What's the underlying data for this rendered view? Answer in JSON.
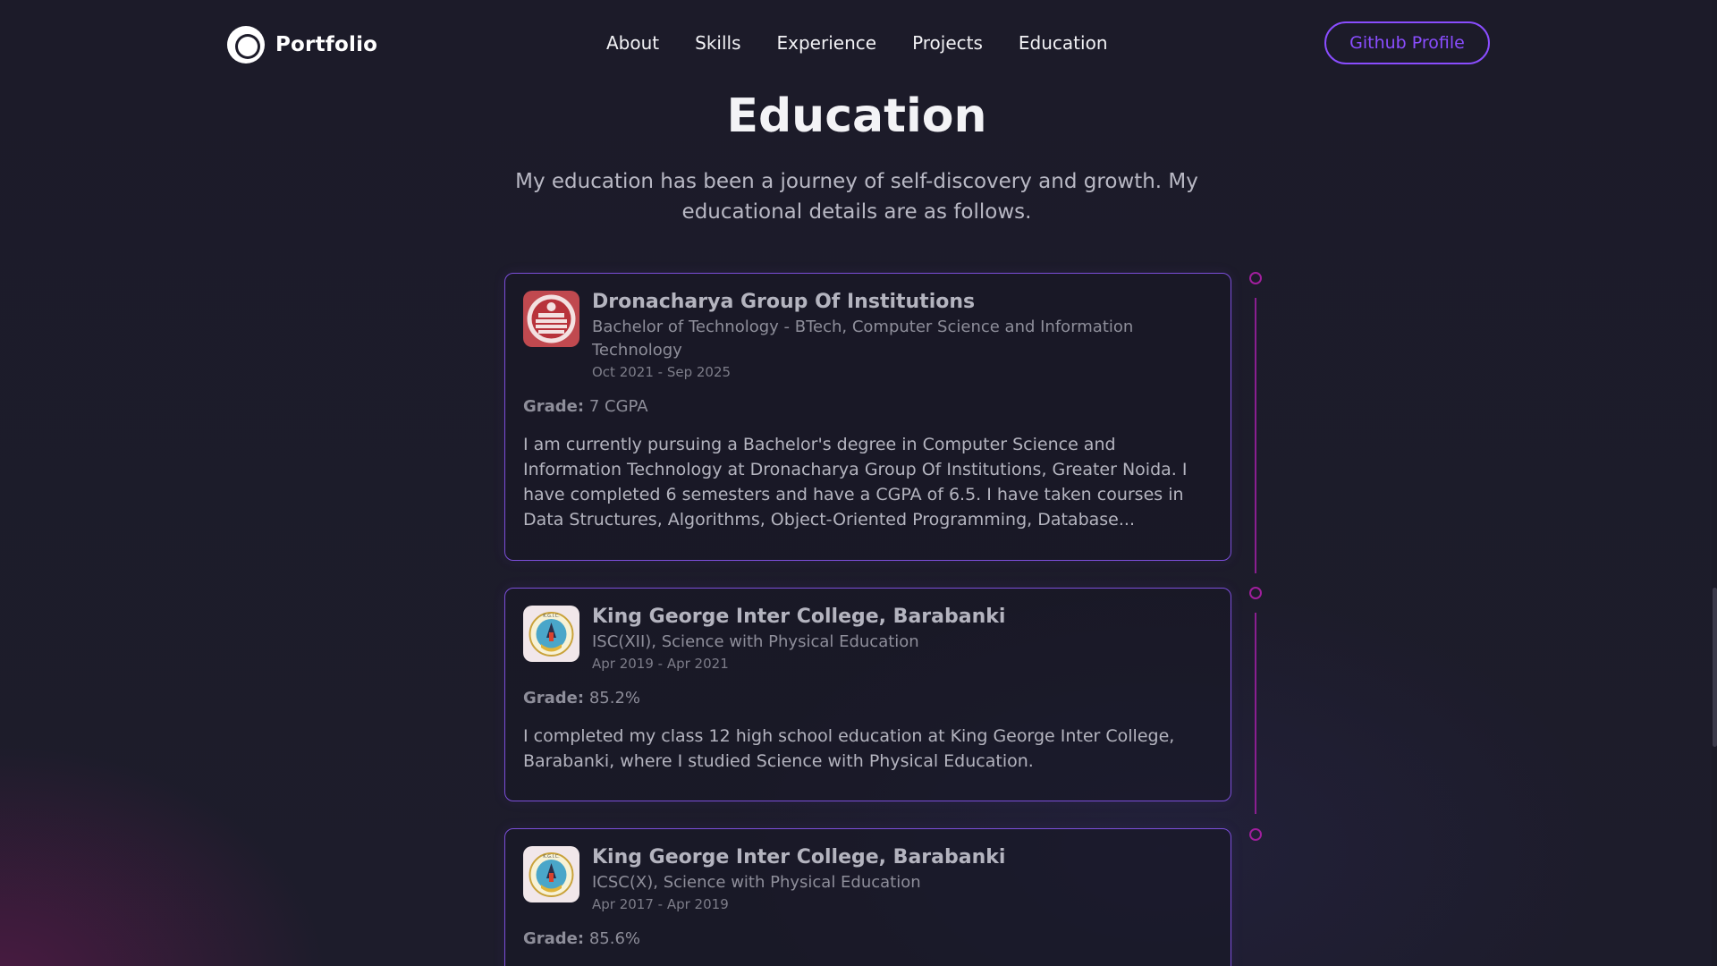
{
  "navbar": {
    "logo_text": "Portfolio",
    "links": [
      "About",
      "Skills",
      "Experience",
      "Projects",
      "Education"
    ],
    "github_button": "Github Profile"
  },
  "section": {
    "title": "Education",
    "description": "My education has been a journey of self-discovery and growth. My educational details are as follows."
  },
  "education": [
    {
      "school": "Dronacharya Group Of Institutions",
      "degree": "Bachelor of Technology - BTech, Computer Science and Information Technology",
      "date": "Oct 2021 - Sep 2025",
      "grade_label": "Grade:",
      "grade": "7 CGPA",
      "description": "I am currently pursuing a Bachelor's degree in Computer Science and Information Technology at Dronacharya Group Of Institutions, Greater Noida. I have completed 6 semesters and have a CGPA of 6.5. I have taken courses in Data Structures, Algorithms, Object-Oriented Programming, Database..."
    },
    {
      "school": "King George Inter College, Barabanki",
      "degree": "ISC(XII), Science with Physical Education",
      "date": "Apr 2019 - Apr 2021",
      "grade_label": "Grade:",
      "grade": "85.2%",
      "description": "I completed my class 12 high school education at King George Inter College, Barabanki, where I studied Science with Physical Education."
    },
    {
      "school": "King George Inter College, Barabanki",
      "degree": "ICSC(X), Science with Physical Education",
      "date": "Apr 2017 - Apr 2019",
      "grade_label": "Grade:",
      "grade": "85.6%",
      "description": ""
    }
  ],
  "colors": {
    "accent": "#8a4dff",
    "timeline": "#a01f9d",
    "background": "#1c1b29"
  }
}
